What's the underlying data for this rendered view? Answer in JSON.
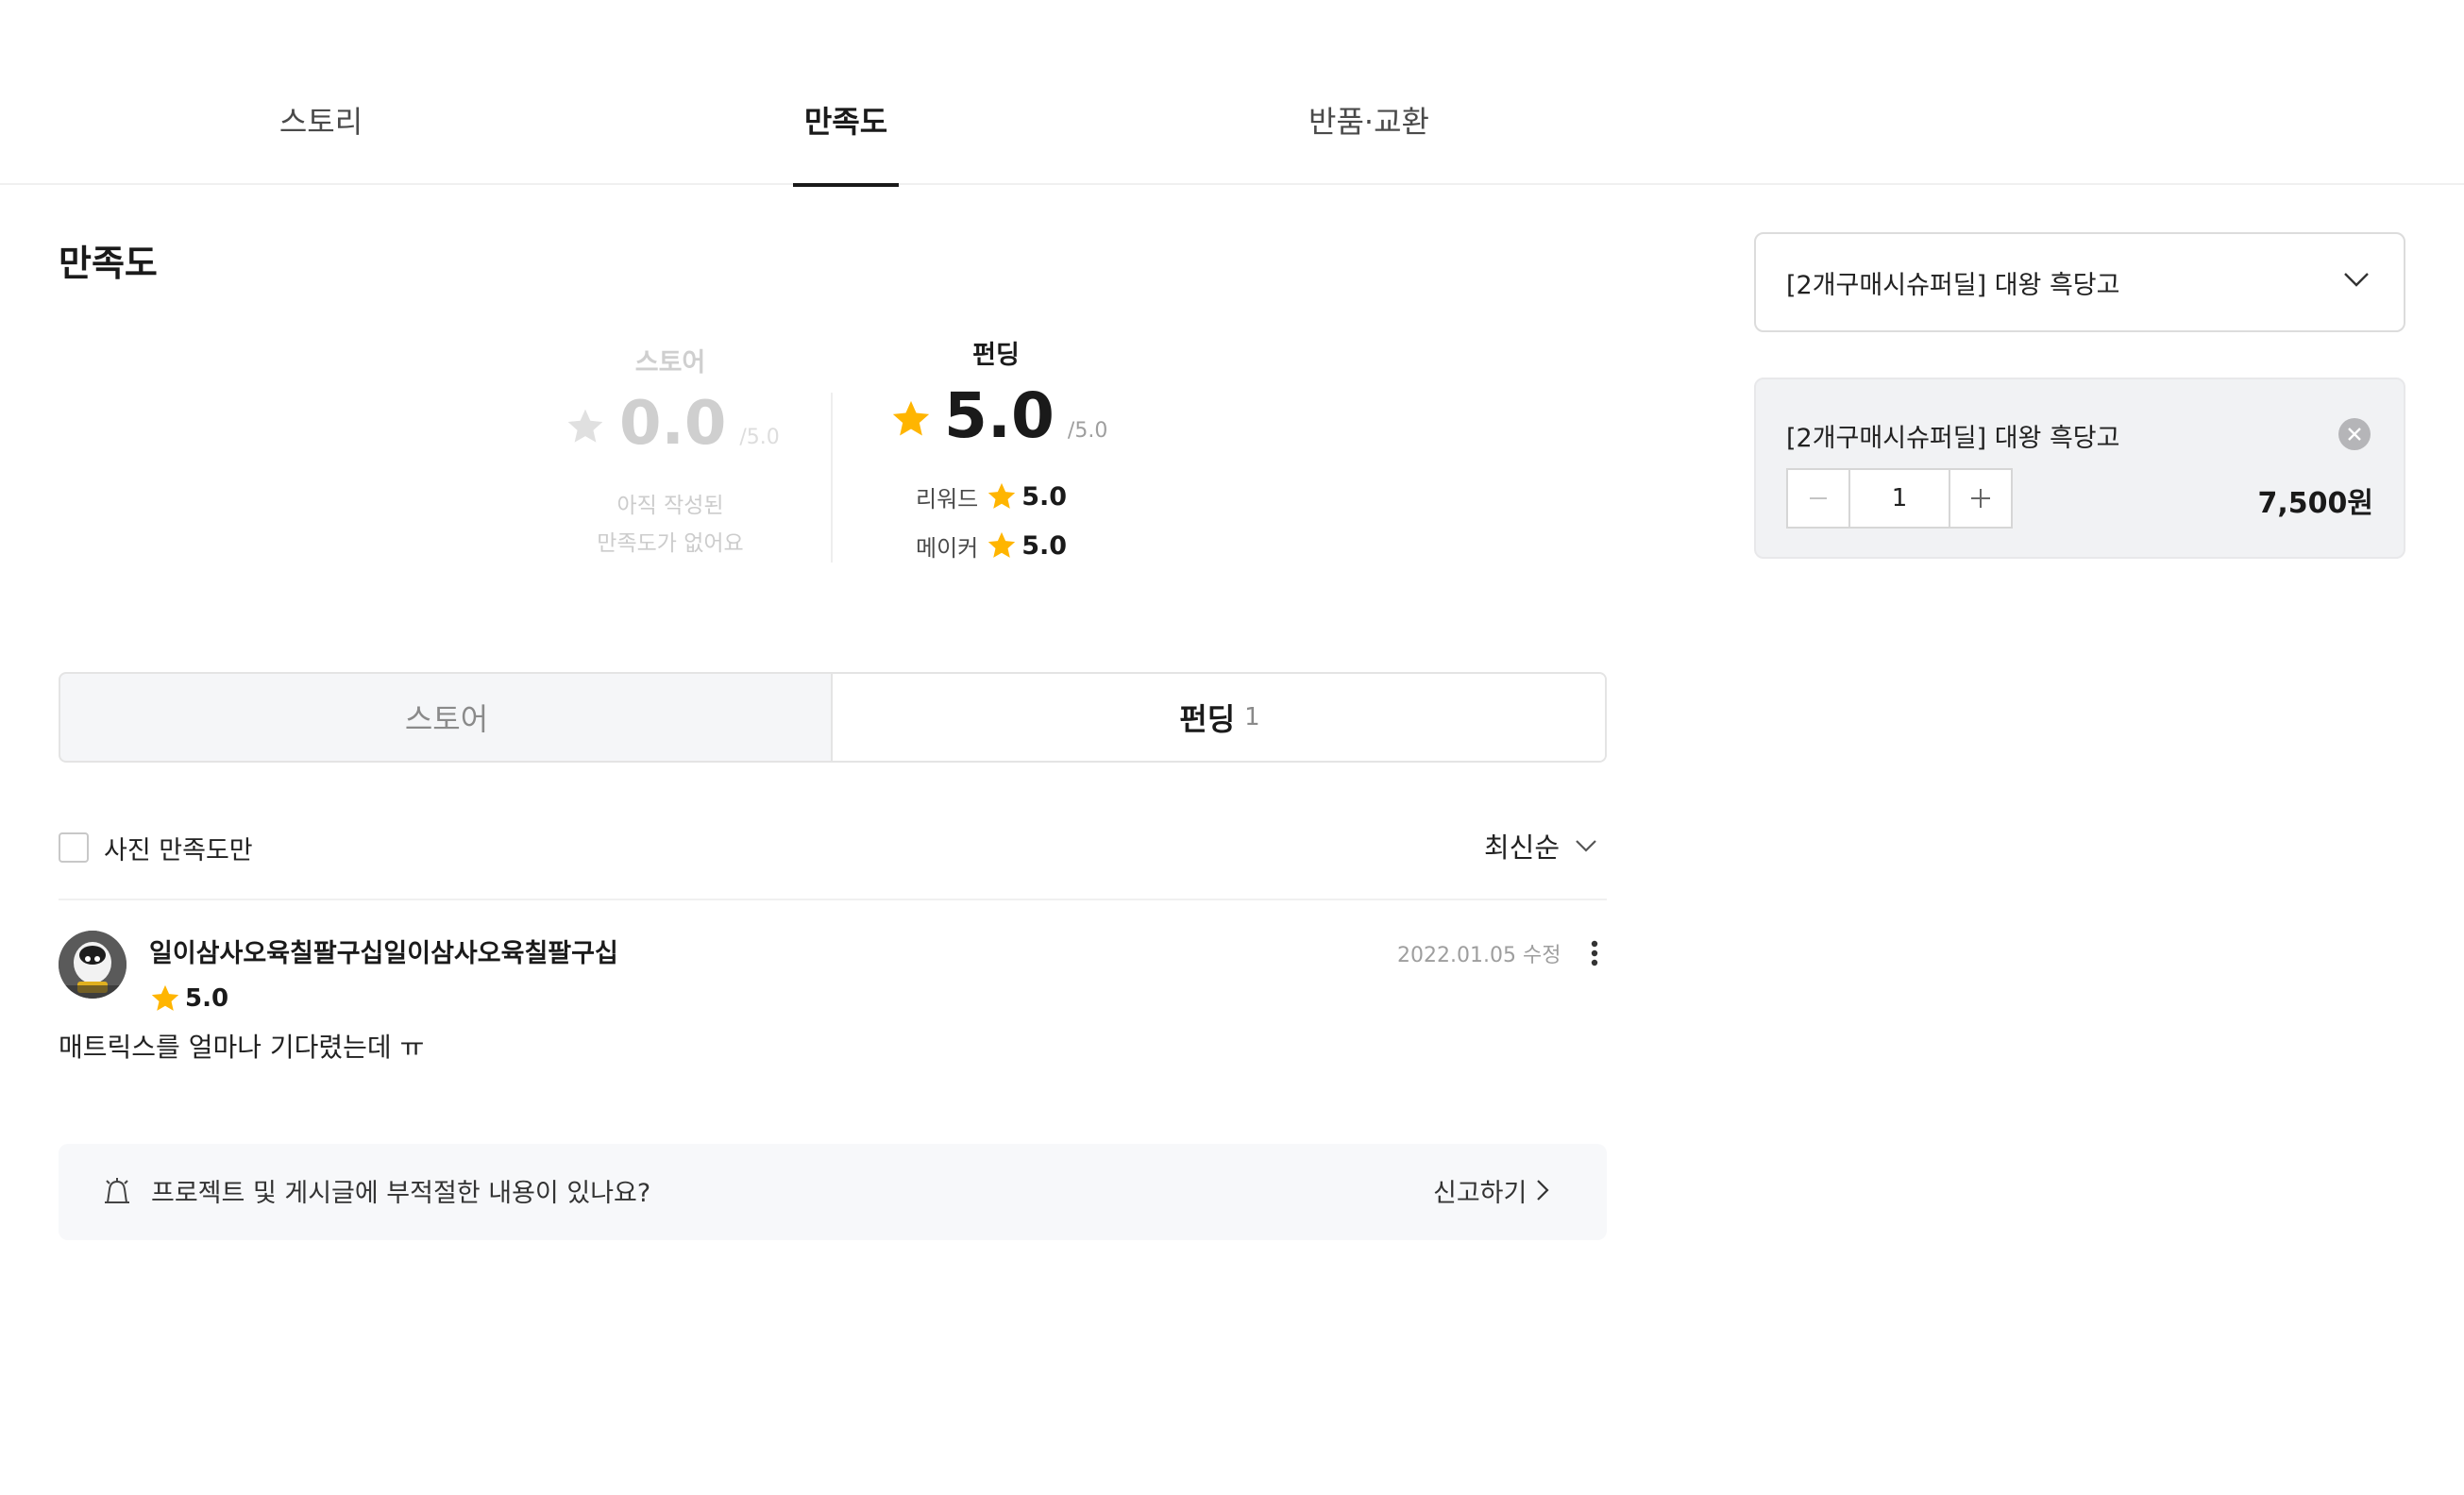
{
  "top_tabs": [
    {
      "label": "스토리"
    },
    {
      "label": "만족도"
    },
    {
      "label": "반품·교환"
    }
  ],
  "section": {
    "title": "만족도"
  },
  "store_summary": {
    "label": "스토어",
    "score": "0.0",
    "max": "/5.0",
    "empty_line1": "아직 작성된",
    "empty_line2": "만족도가 없어요"
  },
  "funding_summary": {
    "label": "펀딩",
    "score": "5.0",
    "max": "/5.0",
    "sub": [
      {
        "label": "리워드",
        "value": "5.0"
      },
      {
        "label": "메이커",
        "value": "5.0"
      }
    ]
  },
  "segment_tabs": {
    "store_label": "스토어",
    "funding_label": "펀딩",
    "funding_count": "1"
  },
  "filter": {
    "photo_only_label": "사진 만족도만",
    "sort_label": "최신순"
  },
  "review": {
    "author": "일이삼사오육칠팔구십일이삼사오육칠팔구십",
    "date": "2022.01.05 수정",
    "rating": "5.0",
    "text": "매트릭스를 얼마나 기다렸는데 ㅠ"
  },
  "report": {
    "message": "프로젝트 및 게시글에 부적절한 내용이 있나요?",
    "link_label": "신고하기"
  },
  "right_panel": {
    "option_select_value": "[2개구매시슈퍼딜] 대왕 흑당고",
    "selected_item_name": "[2개구매시슈퍼딜] 대왕 흑당고",
    "quantity": "1",
    "price": "7,500원"
  },
  "colors": {
    "star": "#FFB500",
    "star_disabled": "#E0E0E0",
    "text_primary": "#1A1A1A",
    "muted": "#9E9E9E"
  },
  "icons": [
    "star-icon",
    "chevron-down-icon",
    "more-vertical-icon",
    "bell-icon",
    "chevron-right-icon",
    "close-circle-icon",
    "minus-icon",
    "plus-icon"
  ]
}
